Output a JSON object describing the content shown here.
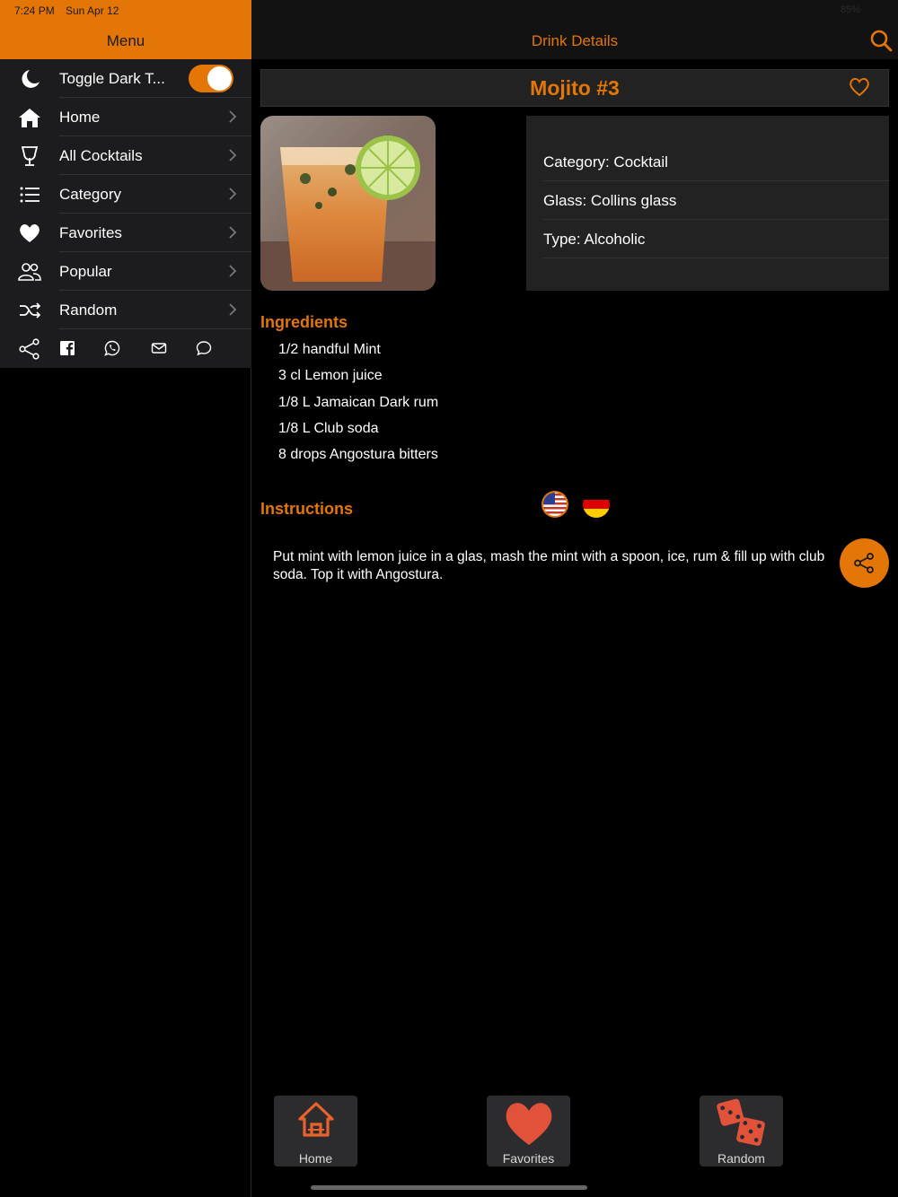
{
  "status_bar": {
    "time": "7:24 PM",
    "date": "Sun Apr 12",
    "battery": "85%"
  },
  "sidebar": {
    "title": "Menu",
    "toggle_label": "Toggle Dark T...",
    "toggle_on": true,
    "items": [
      {
        "label": "Home",
        "icon": "home-icon"
      },
      {
        "label": "All Cocktails",
        "icon": "cocktail-glass-icon"
      },
      {
        "label": "Category",
        "icon": "list-icon"
      },
      {
        "label": "Favorites",
        "icon": "heart-icon"
      },
      {
        "label": "Popular",
        "icon": "people-icon"
      },
      {
        "label": "Random",
        "icon": "shuffle-icon"
      }
    ],
    "share_icons": [
      "share-icon",
      "facebook-icon",
      "whatsapp-icon",
      "mail-icon",
      "message-icon"
    ]
  },
  "header": {
    "title": "Drink Details"
  },
  "drink": {
    "name": "Mojito #3",
    "category": "Category: Cocktail",
    "glass": "Glass: Collins glass",
    "type": "Type: Alcoholic"
  },
  "ingredients": {
    "title": "Ingredients",
    "items": [
      "1/2 handful Mint",
      "3 cl Lemon juice",
      "1/8 L Jamaican Dark rum",
      "1/8 L Club soda",
      "8 drops Angostura bitters"
    ]
  },
  "instructions": {
    "title": "Instructions",
    "languages": [
      "us-flag-icon",
      "german-flag-icon"
    ],
    "text": "Put mint with lemon juice in a glas, mash the mint with a spoon, ice, rum & fill up with club soda. Top it with Angostura."
  },
  "tabbar": {
    "items": [
      {
        "label": "Home",
        "icon": "home-icon"
      },
      {
        "label": "Favorites",
        "icon": "heart-icon"
      },
      {
        "label": "Random",
        "icon": "dice-icon"
      }
    ]
  },
  "colors": {
    "accent": "#e37606",
    "panel": "#222222",
    "background": "#000000",
    "tab": "#2c2c2e"
  }
}
